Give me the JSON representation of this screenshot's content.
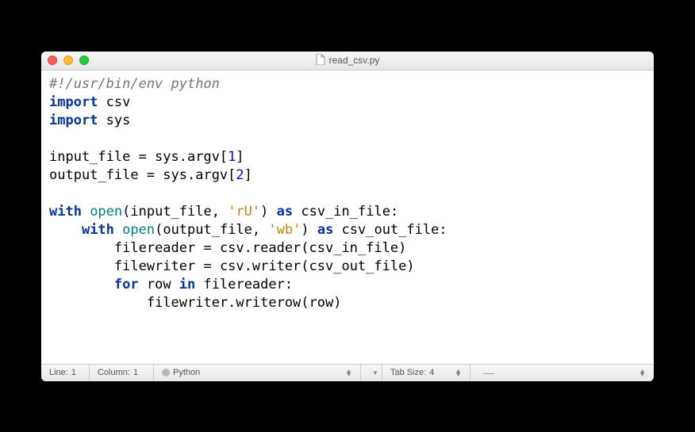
{
  "window": {
    "title": "read_csv.py"
  },
  "code": {
    "line1_shebang": "#!/usr/bin/env python",
    "line2_kw": "import",
    "line2_mod": " csv",
    "line3_kw": "import",
    "line3_mod": " sys",
    "line5_a": "input_file = sys.argv[",
    "line5_num": "1",
    "line5_b": "]",
    "line6_a": "output_file = sys.argv[",
    "line6_num": "2",
    "line6_b": "]",
    "line8_kw1": "with",
    "line8_b1": " open",
    "line8_a": "(input_file, ",
    "line8_str": "'rU'",
    "line8_b": ") ",
    "line8_kw2": "as",
    "line8_c": " csv_in_file:",
    "line9_indent": "    ",
    "line9_kw1": "with",
    "line9_b1": " open",
    "line9_a": "(output_file, ",
    "line9_str": "'wb'",
    "line9_b": ") ",
    "line9_kw2": "as",
    "line9_c": " csv_out_file:",
    "line10_indent": "        ",
    "line10": "filereader = csv.reader(csv_in_file)",
    "line11_indent": "        ",
    "line11": "filewriter = csv.writer(csv_out_file)",
    "line12_indent": "        ",
    "line12_kw1": "for",
    "line12_a": " row ",
    "line12_kw2": "in",
    "line12_b": " filereader:",
    "line13_indent": "            ",
    "line13": "filewriter.writerow(row)"
  },
  "status": {
    "line_label": "Line:",
    "line_value": "1",
    "column_label": "Column:",
    "column_value": "1",
    "syntax": "Python",
    "tabsize_label": "Tab Size:",
    "tabsize_value": "4"
  }
}
